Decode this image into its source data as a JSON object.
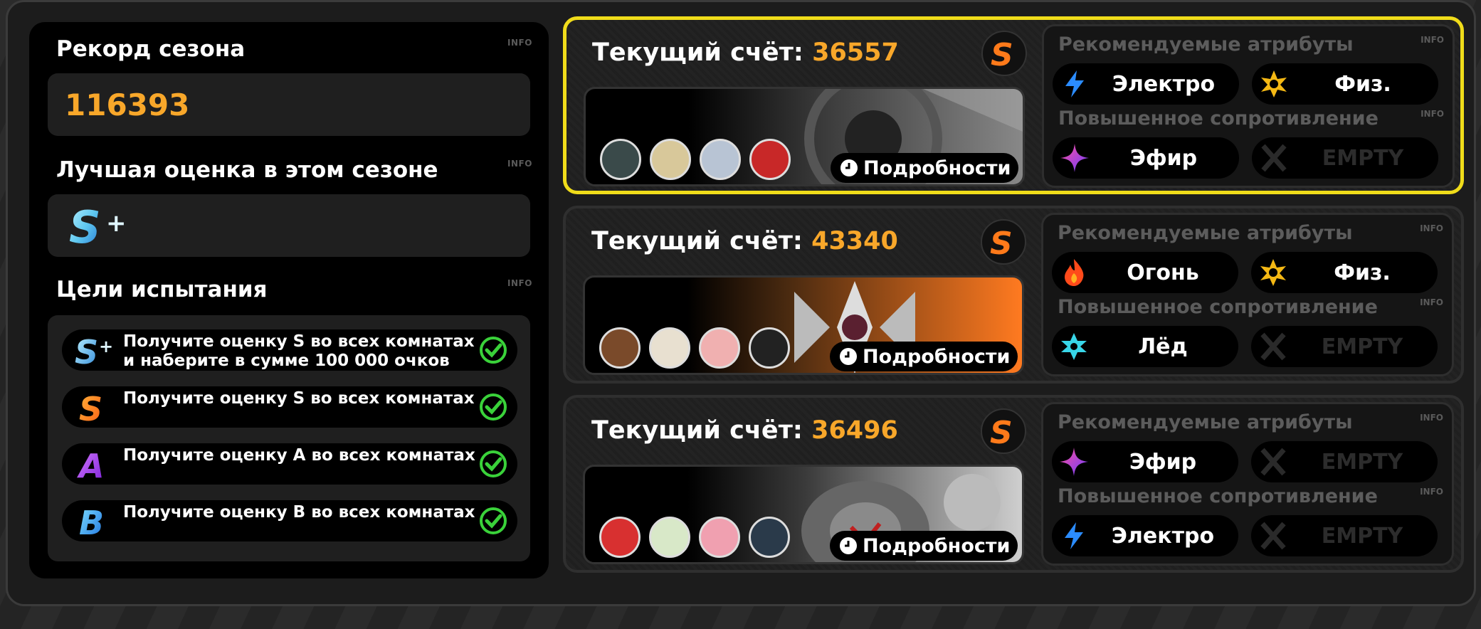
{
  "left": {
    "season_record": {
      "title": "Рекорд сезона",
      "info": "INFO",
      "value": "116393"
    },
    "best_rating": {
      "title": "Лучшая оценка в этом сезоне",
      "info": "INFO",
      "rank": "S+"
    },
    "goals": {
      "title": "Цели испытания",
      "info": "INFO",
      "items": [
        {
          "rank": "S+",
          "text": "Получите оценку S во всех комнатах и наберите в сумме 100 000 очков",
          "done": true
        },
        {
          "rank": "S",
          "text": "Получите оценку S во всех комнатах",
          "done": true
        },
        {
          "rank": "A",
          "text": "Получите оценку A во всех комнатах",
          "done": true
        },
        {
          "rank": "B",
          "text": "Получите оценку B во всех комнатах",
          "done": true
        }
      ]
    }
  },
  "rooms": [
    {
      "score_label": "Текущий счёт:",
      "score": "36557",
      "rank": "S",
      "details": "Подробности",
      "recommended_title": "Рекомендуемые атрибуты",
      "resistance_title": "Повышенное сопротивление",
      "info": "INFO",
      "recommended": [
        {
          "icon": "electric-icon",
          "label": "Электро"
        },
        {
          "icon": "physical-icon",
          "label": "Физ."
        }
      ],
      "resistance": [
        {
          "icon": "ether-icon",
          "label": "Эфир"
        },
        {
          "icon": "empty-x-icon",
          "label": "EMPTY"
        }
      ]
    },
    {
      "score_label": "Текущий счёт:",
      "score": "43340",
      "rank": "S",
      "details": "Подробности",
      "recommended_title": "Рекомендуемые атрибуты",
      "resistance_title": "Повышенное сопротивление",
      "info": "INFO",
      "recommended": [
        {
          "icon": "fire-icon",
          "label": "Огонь"
        },
        {
          "icon": "physical-icon",
          "label": "Физ."
        }
      ],
      "resistance": [
        {
          "icon": "ice-icon",
          "label": "Лёд"
        },
        {
          "icon": "empty-x-icon",
          "label": "EMPTY"
        }
      ]
    },
    {
      "score_label": "Текущий счёт:",
      "score": "36496",
      "rank": "S",
      "details": "Подробности",
      "recommended_title": "Рекомендуемые атрибуты",
      "resistance_title": "Повышенное сопротивление",
      "info": "INFO",
      "recommended": [
        {
          "icon": "ether-icon",
          "label": "Эфир"
        },
        {
          "icon": "empty-x-icon",
          "label": "EMPTY"
        }
      ],
      "resistance": [
        {
          "icon": "electric-icon",
          "label": "Электро"
        },
        {
          "icon": "empty-x-icon",
          "label": "EMPTY"
        }
      ]
    }
  ],
  "colors": {
    "accent_orange": "#f8a72a",
    "selected_border": "#f0dc1a",
    "check_green": "#3ad23a"
  }
}
